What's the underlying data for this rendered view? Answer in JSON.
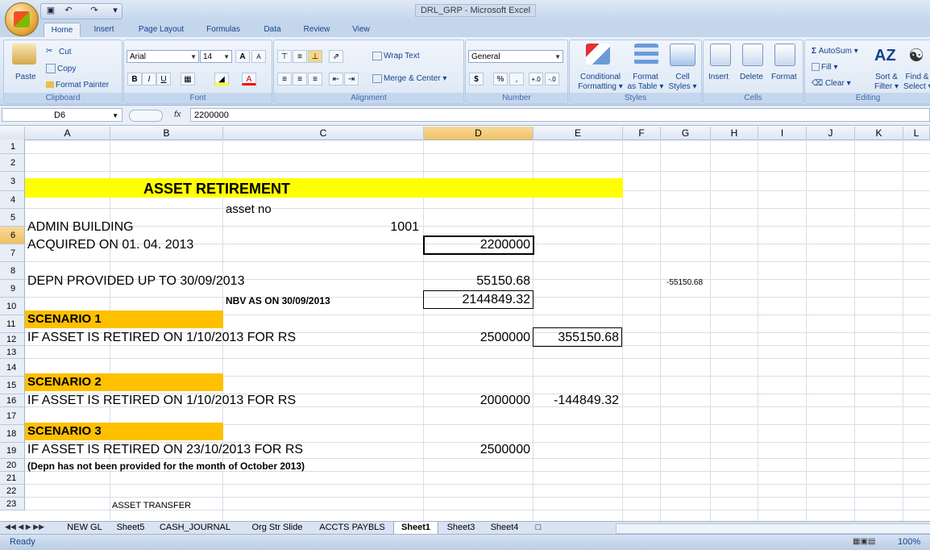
{
  "window": {
    "title": "DRL_GRP - Microsoft Excel"
  },
  "tabs": [
    "Home",
    "Insert",
    "Page Layout",
    "Formulas",
    "Data",
    "Review",
    "View"
  ],
  "ribbon": {
    "clipboard": {
      "label": "Clipboard",
      "paste": "Paste",
      "cut": "Cut",
      "copy": "Copy",
      "format_painter": "Format Painter"
    },
    "font": {
      "label": "Font",
      "name": "Arial",
      "size": "14",
      "bold": "B",
      "italic": "I",
      "underline": "U",
      "grow": "A",
      "shrink": "A"
    },
    "alignment": {
      "label": "Alignment",
      "wrap": "Wrap Text",
      "merge": "Merge & Center"
    },
    "number": {
      "label": "Number",
      "format": "General",
      "currency": "$",
      "percent": "%",
      "comma": ",",
      "inc": "+.0",
      "dec": "-.0"
    },
    "styles": {
      "label": "Styles",
      "conditional": "Conditional",
      "conditional2": "Formatting",
      "format_table": "Format",
      "format_table2": "as Table",
      "cell_styles": "Cell",
      "cell_styles2": "Styles"
    },
    "cells": {
      "label": "Cells",
      "insert": "Insert",
      "delete": "Delete",
      "format": "Format"
    },
    "editing": {
      "label": "Editing",
      "autosum": "AutoSum",
      "fill": "Fill",
      "clear": "Clear",
      "sort": "Sort &",
      "sort2": "Filter",
      "find": "Find &",
      "find2": "Select"
    }
  },
  "formula_bar": {
    "name_box": "D6",
    "fx": "fx",
    "formula": "2200000"
  },
  "columns": [
    "A",
    "B",
    "C",
    "D",
    "E",
    "F",
    "G",
    "H",
    "I",
    "J",
    "K",
    "L"
  ],
  "rows": [
    "1",
    "2",
    "3",
    "4",
    "5",
    "6",
    "7",
    "8",
    "9",
    "10",
    "11",
    "12",
    "13",
    "14",
    "15",
    "16",
    "17",
    "18",
    "19",
    "20",
    "21",
    "22",
    "23"
  ],
  "cells": {
    "title": "ASSET RETIREMENT",
    "c4": "asset no",
    "a5": "ADMIN BUILDING",
    "c5": "1001",
    "a6": "ACQUIRED ON 01. 04. 2013",
    "d6": "2200000",
    "a8": "DEPN PROVIDED UP TO 30/09/2013",
    "d8": "55150.68",
    "g8": "-55150.68",
    "c9": "NBV AS ON 30/09/2013",
    "d9": "2144849.32",
    "a10": "SCENARIO 1",
    "a11": "IF ASSET IS RETIRED ON 1/10/2013  FOR RS",
    "d11": "2500000",
    "e11": "355150.68",
    "a14": "SCENARIO 2",
    "a15": "IF ASSET IS RETIRED ON 1/10/2013  FOR RS",
    "d15": "2000000",
    "e15": "-144849.32",
    "a17": "SCENARIO 3",
    "a18": "IF ASSET IS RETIRED ON 23/10/2013   FOR RS",
    "d18": "2500000",
    "a19": "(Depn has not been provided for the month of October 2013)",
    "b22": "ASSET TRANSFER"
  },
  "sheets": [
    "NEW GL",
    "Sheet5",
    "CASH_JOURNAL",
    "Org Str Slide",
    "ACCTS PAYBLS",
    "Sheet1",
    "Sheet3",
    "Sheet4"
  ],
  "active_sheet": "Sheet1",
  "status": {
    "ready": "Ready",
    "zoom": "100%"
  },
  "colors": {
    "title_fill": "#FFFF00",
    "scenario_fill": "#FFC000",
    "selected_header": "#F1C15F"
  }
}
